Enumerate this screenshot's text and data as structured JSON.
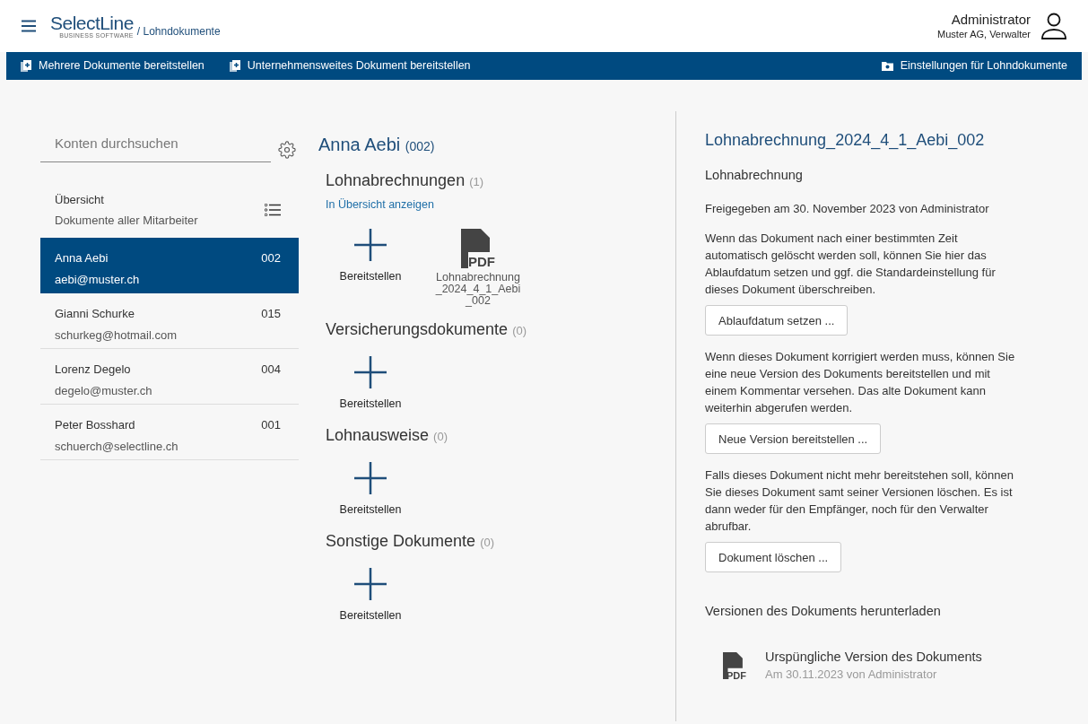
{
  "header": {
    "logo": "SelectLine",
    "logo_tagline": "BUSINESS SOFTWARE",
    "breadcrumb": "/ Lohndokumente",
    "user_name": "Administrator",
    "user_role": "Muster AG, Verwalter"
  },
  "toolbar": {
    "left": [
      "Mehrere Dokumente bereitstellen",
      "Unternehmensweites Dokument bereitstellen"
    ],
    "right": "Einstellungen für Lohndokumente"
  },
  "sidebar": {
    "search": {
      "placeholder": "Konten durchsuchen"
    },
    "overview": {
      "title": "Übersicht",
      "subtitle": "Dokumente aller Mitarbeiter"
    },
    "items": [
      {
        "name": "Anna Aebi",
        "email": "aebi@muster.ch",
        "number": "002",
        "selected": true
      },
      {
        "name": "Gianni Schurke",
        "email": "schurkeg@hotmail.com",
        "number": "015",
        "selected": false
      },
      {
        "name": "Lorenz Degelo",
        "email": "degelo@muster.ch",
        "number": "004",
        "selected": false
      },
      {
        "name": "Peter Bosshard",
        "email": "schuerch@selectline.ch",
        "number": "001",
        "selected": false
      }
    ]
  },
  "employee": {
    "name": "Anna Aebi",
    "number": "(002)"
  },
  "sections": [
    {
      "title": "Lohnabrechnungen",
      "count": "(1)",
      "link": "In Übersicht anzeigen",
      "items": [
        {
          "kind": "add",
          "label": "Bereitstellen"
        },
        {
          "kind": "document",
          "badge": "PDF",
          "label": "Lohnabrechnung_2024_4_1_Aebi_002"
        }
      ]
    },
    {
      "title": "Versicherungsdokumente",
      "count": "(0)",
      "items": [
        {
          "kind": "add",
          "label": "Bereitstellen"
        }
      ]
    },
    {
      "title": "Lohnausweise",
      "count": "(0)",
      "items": [
        {
          "kind": "add",
          "label": "Bereitstellen"
        }
      ]
    },
    {
      "title": "Sonstige Dokumente",
      "count": "(0)",
      "items": [
        {
          "kind": "add",
          "label": "Bereitstellen"
        }
      ]
    }
  ],
  "detail": {
    "title": "Lohnabrechnung_2024_4_1_Aebi_002",
    "type": "Lohnabrechnung",
    "released": "Freigegeben am 30. November 2023 von Administrator",
    "blocks": [
      {
        "text": "Wenn das Dokument nach einer bestimmten Zeit automatisch gelöscht werden soll, können Sie hier das Ablaufdatum setzen und ggf. die Standardeinstellung für dieses Dokument überschreiben.",
        "button": "Ablaufdatum setzen ..."
      },
      {
        "text": "Wenn dieses Dokument korrigiert werden muss, können Sie eine neue Version des Dokuments bereitstellen und mit einem Kommentar versehen. Das alte Dokument kann weiterhin abgerufen werden.",
        "button": "Neue Version bereitstellen ..."
      },
      {
        "text": "Falls dieses Dokument nicht mehr bereitstehen soll, können Sie dieses Dokument samt seiner Versionen löschen. Es ist dann weder für den Empfänger, noch für den Verwalter abrufbar.",
        "button": "Dokument löschen ..."
      }
    ],
    "versions_title": "Versionen des Dokuments herunterladen",
    "versions": [
      {
        "badge": "PDF",
        "title": "Urspüngliche Version des Dokuments",
        "meta": "Am 30.11.2023 von Administrator"
      }
    ]
  }
}
